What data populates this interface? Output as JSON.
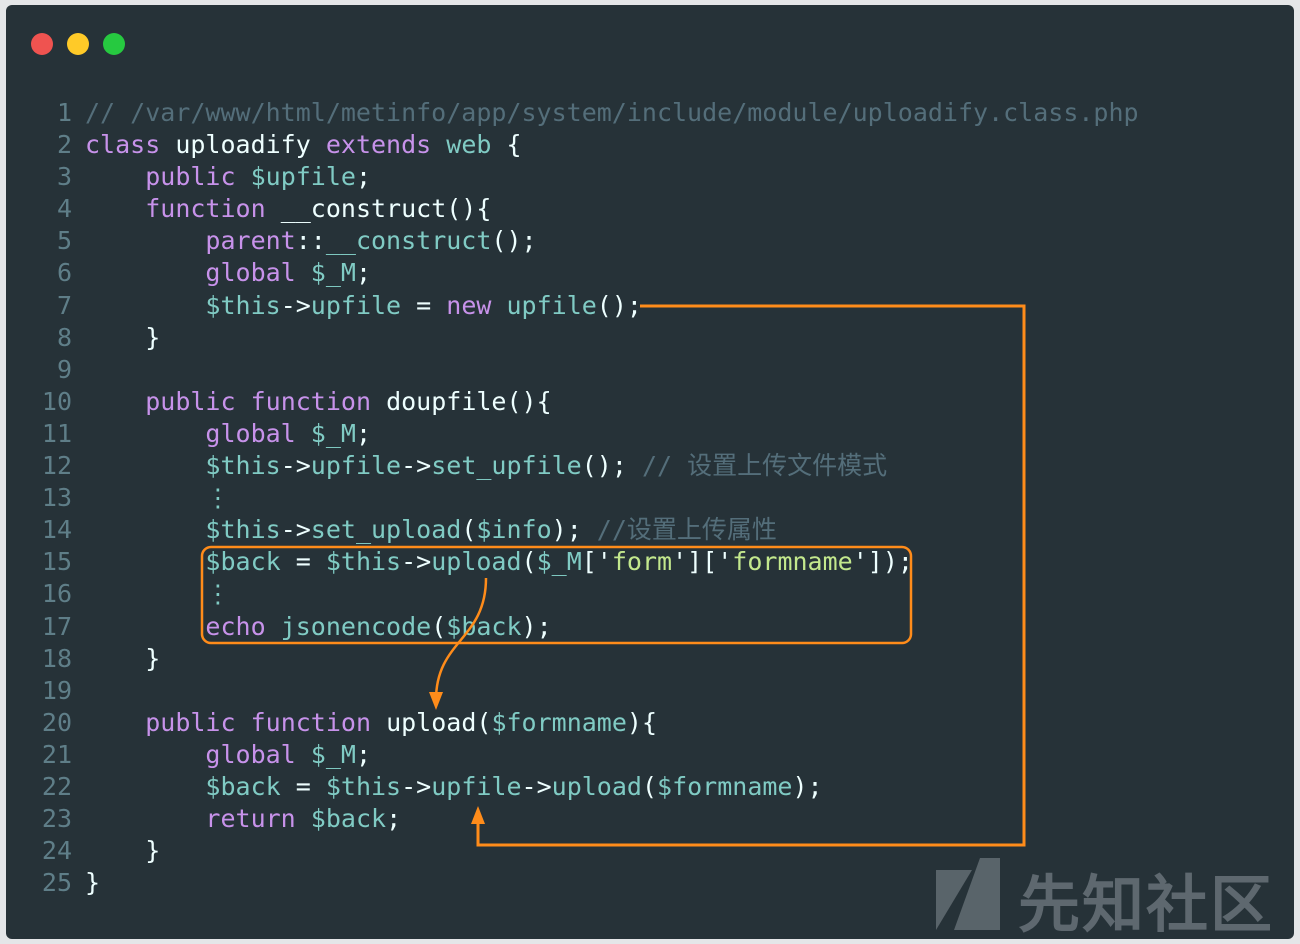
{
  "window": {
    "controls": [
      {
        "name": "close",
        "color": "#ef5350"
      },
      {
        "name": "minimize",
        "color": "#ffca28"
      },
      {
        "name": "maximize",
        "color": "#26c940"
      }
    ]
  },
  "code": {
    "lines": [
      {
        "n": "1",
        "tokens": [
          {
            "t": "// /var/www/html/metinfo/app/system/include/module/uploadify.class.php",
            "c": "cm"
          }
        ]
      },
      {
        "n": "2",
        "tokens": [
          {
            "t": "class",
            "c": "kw"
          },
          {
            "t": " uploadify ",
            "c": "pl"
          },
          {
            "t": "extends",
            "c": "kw"
          },
          {
            "t": " ",
            "c": "pl"
          },
          {
            "t": "web",
            "c": "var"
          },
          {
            "t": " {",
            "c": "pl"
          }
        ]
      },
      {
        "n": "3",
        "tokens": [
          {
            "t": "    ",
            "c": "pl"
          },
          {
            "t": "public",
            "c": "kw"
          },
          {
            "t": " ",
            "c": "pl"
          },
          {
            "t": "$upfile",
            "c": "var"
          },
          {
            "t": ";",
            "c": "pl"
          }
        ]
      },
      {
        "n": "4",
        "tokens": [
          {
            "t": "    ",
            "c": "pl"
          },
          {
            "t": "function",
            "c": "kw"
          },
          {
            "t": " __construct(){",
            "c": "pl"
          }
        ]
      },
      {
        "n": "5",
        "tokens": [
          {
            "t": "        ",
            "c": "pl"
          },
          {
            "t": "parent",
            "c": "kw"
          },
          {
            "t": "::",
            "c": "pl"
          },
          {
            "t": "__construct",
            "c": "var"
          },
          {
            "t": "();",
            "c": "pl"
          }
        ]
      },
      {
        "n": "6",
        "tokens": [
          {
            "t": "        ",
            "c": "pl"
          },
          {
            "t": "global",
            "c": "kw"
          },
          {
            "t": " ",
            "c": "pl"
          },
          {
            "t": "$_M",
            "c": "var"
          },
          {
            "t": ";",
            "c": "pl"
          }
        ]
      },
      {
        "n": "7",
        "tokens": [
          {
            "t": "        ",
            "c": "pl"
          },
          {
            "t": "$this",
            "c": "var"
          },
          {
            "t": "->",
            "c": "pl"
          },
          {
            "t": "upfile",
            "c": "var"
          },
          {
            "t": " = ",
            "c": "pl"
          },
          {
            "t": "new",
            "c": "kw"
          },
          {
            "t": " ",
            "c": "pl"
          },
          {
            "t": "upfile",
            "c": "var"
          },
          {
            "t": "();",
            "c": "pl"
          }
        ]
      },
      {
        "n": "8",
        "tokens": [
          {
            "t": "    }",
            "c": "pl"
          }
        ]
      },
      {
        "n": "9",
        "tokens": []
      },
      {
        "n": "10",
        "tokens": [
          {
            "t": "    ",
            "c": "pl"
          },
          {
            "t": "public",
            "c": "kw"
          },
          {
            "t": " ",
            "c": "pl"
          },
          {
            "t": "function",
            "c": "kw"
          },
          {
            "t": " doupfile(){",
            "c": "pl"
          }
        ]
      },
      {
        "n": "11",
        "tokens": [
          {
            "t": "        ",
            "c": "pl"
          },
          {
            "t": "global",
            "c": "kw"
          },
          {
            "t": " ",
            "c": "pl"
          },
          {
            "t": "$_M",
            "c": "var"
          },
          {
            "t": ";",
            "c": "pl"
          }
        ]
      },
      {
        "n": "12",
        "tokens": [
          {
            "t": "        ",
            "c": "pl"
          },
          {
            "t": "$this",
            "c": "var"
          },
          {
            "t": "->",
            "c": "pl"
          },
          {
            "t": "upfile",
            "c": "var"
          },
          {
            "t": "->",
            "c": "pl"
          },
          {
            "t": "set_upfile",
            "c": "var"
          },
          {
            "t": "(); ",
            "c": "pl"
          },
          {
            "t": "// 设置上传文件模式",
            "c": "cm"
          }
        ]
      },
      {
        "n": "13",
        "tokens": [
          {
            "t": "        ",
            "c": "pl"
          },
          {
            "t": "⋮",
            "c": "dotsv"
          }
        ]
      },
      {
        "n": "14",
        "tokens": [
          {
            "t": "        ",
            "c": "pl"
          },
          {
            "t": "$this",
            "c": "var"
          },
          {
            "t": "->",
            "c": "pl"
          },
          {
            "t": "set_upload",
            "c": "var"
          },
          {
            "t": "(",
            "c": "pl"
          },
          {
            "t": "$info",
            "c": "var"
          },
          {
            "t": "); ",
            "c": "pl"
          },
          {
            "t": "//设置上传属性",
            "c": "cm"
          }
        ]
      },
      {
        "n": "15",
        "tokens": [
          {
            "t": "        ",
            "c": "pl"
          },
          {
            "t": "$back",
            "c": "var"
          },
          {
            "t": " = ",
            "c": "pl"
          },
          {
            "t": "$this",
            "c": "var"
          },
          {
            "t": "->",
            "c": "pl"
          },
          {
            "t": "upload",
            "c": "var"
          },
          {
            "t": "(",
            "c": "pl"
          },
          {
            "t": "$_M",
            "c": "var"
          },
          {
            "t": "['",
            "c": "pl"
          },
          {
            "t": "form",
            "c": "str"
          },
          {
            "t": "']['",
            "c": "pl"
          },
          {
            "t": "formname",
            "c": "str"
          },
          {
            "t": "']);",
            "c": "pl"
          }
        ]
      },
      {
        "n": "16",
        "tokens": [
          {
            "t": "        ",
            "c": "pl"
          },
          {
            "t": "⋮",
            "c": "dotsv"
          }
        ]
      },
      {
        "n": "17",
        "tokens": [
          {
            "t": "        ",
            "c": "pl"
          },
          {
            "t": "echo",
            "c": "kw"
          },
          {
            "t": " ",
            "c": "pl"
          },
          {
            "t": "jsonencode",
            "c": "var"
          },
          {
            "t": "(",
            "c": "pl"
          },
          {
            "t": "$back",
            "c": "var"
          },
          {
            "t": ");",
            "c": "pl"
          }
        ]
      },
      {
        "n": "18",
        "tokens": [
          {
            "t": "    }",
            "c": "pl"
          }
        ]
      },
      {
        "n": "19",
        "tokens": []
      },
      {
        "n": "20",
        "tokens": [
          {
            "t": "    ",
            "c": "pl"
          },
          {
            "t": "public",
            "c": "kw"
          },
          {
            "t": " ",
            "c": "pl"
          },
          {
            "t": "function",
            "c": "kw"
          },
          {
            "t": " upload(",
            "c": "pl"
          },
          {
            "t": "$formname",
            "c": "var"
          },
          {
            "t": "){",
            "c": "pl"
          }
        ]
      },
      {
        "n": "21",
        "tokens": [
          {
            "t": "        ",
            "c": "pl"
          },
          {
            "t": "global",
            "c": "kw"
          },
          {
            "t": " ",
            "c": "pl"
          },
          {
            "t": "$_M",
            "c": "var"
          },
          {
            "t": ";",
            "c": "pl"
          }
        ]
      },
      {
        "n": "22",
        "tokens": [
          {
            "t": "        ",
            "c": "pl"
          },
          {
            "t": "$back",
            "c": "var"
          },
          {
            "t": " = ",
            "c": "pl"
          },
          {
            "t": "$this",
            "c": "var"
          },
          {
            "t": "->",
            "c": "pl"
          },
          {
            "t": "upfile",
            "c": "var"
          },
          {
            "t": "->",
            "c": "pl"
          },
          {
            "t": "upload",
            "c": "var"
          },
          {
            "t": "(",
            "c": "pl"
          },
          {
            "t": "$formname",
            "c": "var"
          },
          {
            "t": ");",
            "c": "pl"
          }
        ]
      },
      {
        "n": "23",
        "tokens": [
          {
            "t": "        ",
            "c": "pl"
          },
          {
            "t": "return",
            "c": "kw"
          },
          {
            "t": " ",
            "c": "pl"
          },
          {
            "t": "$back",
            "c": "var"
          },
          {
            "t": ";",
            "c": "pl"
          }
        ]
      },
      {
        "n": "24",
        "tokens": [
          {
            "t": "    }",
            "c": "pl"
          }
        ]
      },
      {
        "n": "25",
        "tokens": [
          {
            "t": "}",
            "c": "pl"
          }
        ]
      }
    ]
  },
  "annotations": {
    "color": "#ff8c1a"
  },
  "watermark": {
    "text": "先知社区"
  }
}
